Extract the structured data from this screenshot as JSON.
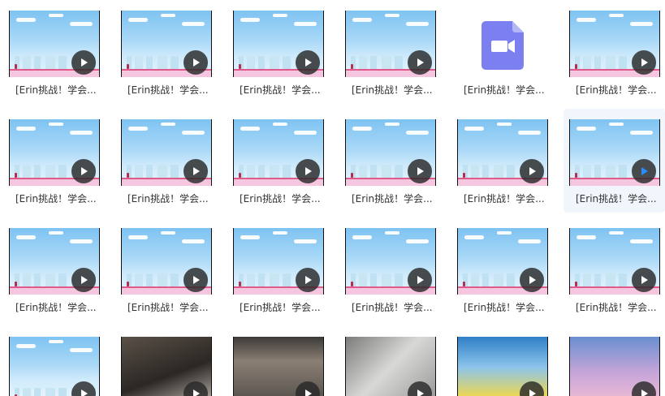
{
  "files": [
    {
      "name": "[Erin挑战！学会...",
      "thumb": "sky"
    },
    {
      "name": "[Erin挑战！学会...",
      "thumb": "sky"
    },
    {
      "name": "[Erin挑战！学会...",
      "thumb": "sky"
    },
    {
      "name": "[Erin挑战！学会...",
      "thumb": "sky"
    },
    {
      "name": "[Erin挑战！学会...",
      "thumb": "video-file-icon"
    },
    {
      "name": "[Erin挑战！学会...",
      "thumb": "sky"
    },
    {
      "name": "[Erin挑战！学会...",
      "thumb": "sky"
    },
    {
      "name": "[Erin挑战！学会...",
      "thumb": "sky"
    },
    {
      "name": "[Erin挑战！学会...",
      "thumb": "sky"
    },
    {
      "name": "[Erin挑战！学会...",
      "thumb": "sky"
    },
    {
      "name": "[Erin挑战！学会...",
      "thumb": "sky"
    },
    {
      "name": "[Erin挑战！学会...",
      "thumb": "sky",
      "hovered": true
    },
    {
      "name": "[Erin挑战！学会...",
      "thumb": "sky"
    },
    {
      "name": "[Erin挑战！学会...",
      "thumb": "sky"
    },
    {
      "name": "[Erin挑战！学会...",
      "thumb": "sky"
    },
    {
      "name": "[Erin挑战！学会...",
      "thumb": "sky"
    },
    {
      "name": "[Erin挑战！学会...",
      "thumb": "sky"
    },
    {
      "name": "[Erin挑战！学会...",
      "thumb": "sky"
    },
    {
      "name": "",
      "thumb": "sky"
    },
    {
      "name": "",
      "thumb": "dark1"
    },
    {
      "name": "",
      "thumb": "dark2"
    },
    {
      "name": "",
      "thumb": "gray"
    },
    {
      "name": "",
      "thumb": "kids1"
    },
    {
      "name": "",
      "thumb": "kids2"
    }
  ],
  "colors": {
    "play_icon": "#ffffff",
    "play_icon_hover": "#2a8cff",
    "video_file_icon": "#7b7ff0"
  }
}
